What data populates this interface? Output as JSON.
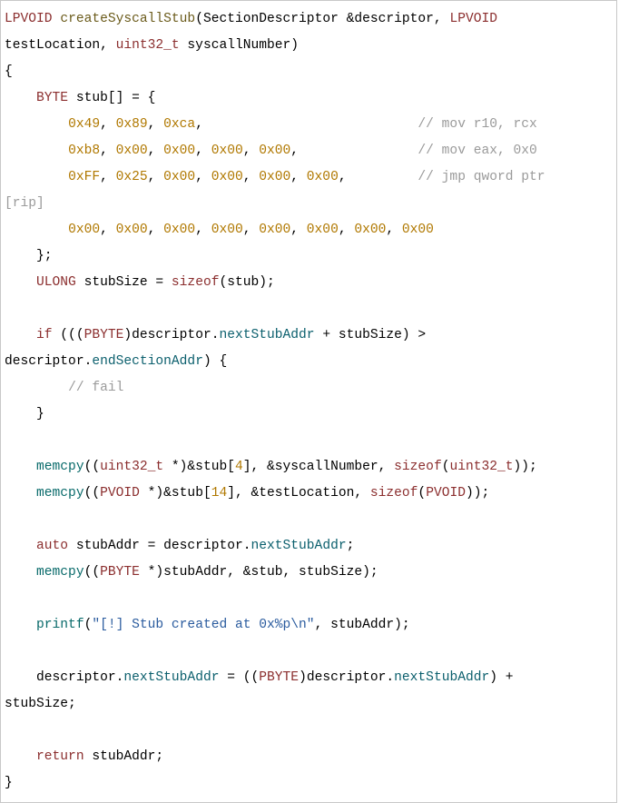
{
  "code": {
    "l1a": "LPVOID",
    "l1b": "createSyscallStub",
    "l1c": "(SectionDescriptor &descriptor, ",
    "l1d": "LPVOID",
    "l2a": "testLocation, ",
    "l2b": "uint32_t",
    "l2c": " syscallNumber)",
    "l3": "{",
    "l4a": "    ",
    "l4b": "BYTE",
    "l4c": " stub[] = {",
    "l5a": "        ",
    "l5b": "0x49",
    "l5c": ", ",
    "l5d": "0x89",
    "l5e": ", ",
    "l5f": "0xca",
    "l5g": ",                           ",
    "l5h": "// mov r10, rcx",
    "l6a": "        ",
    "l6b": "0xb8",
    "l6c": ", ",
    "l6d": "0x00",
    "l6e": ", ",
    "l6f": "0x00",
    "l6g": ", ",
    "l6h": "0x00",
    "l6i": ", ",
    "l6j": "0x00",
    "l6k": ",               ",
    "l6l": "// mov eax, 0x0",
    "l7a": "        ",
    "l7b": "0xFF",
    "l7c": ", ",
    "l7d": "0x25",
    "l7e": ", ",
    "l7f": "0x00",
    "l7g": ", ",
    "l7h": "0x00",
    "l7i": ", ",
    "l7j": "0x00",
    "l7k": ", ",
    "l7l": "0x00",
    "l7m": ",         ",
    "l7n": "// jmp qword ptr",
    "l8": "[rip]",
    "l9a": "        ",
    "l9b": "0x00",
    "l9c": ", ",
    "l9d": "0x00",
    "l9e": ", ",
    "l9f": "0x00",
    "l9g": ", ",
    "l9h": "0x00",
    "l9i": ", ",
    "l9j": "0x00",
    "l9k": ", ",
    "l9l": "0x00",
    "l9m": ", ",
    "l9n": "0x00",
    "l9o": ", ",
    "l9p": "0x00",
    "l10": "    };",
    "l11a": "    ",
    "l11b": "ULONG",
    "l11c": " stubSize = ",
    "l11d": "sizeof",
    "l11e": "(stub);",
    "l12": "",
    "l13a": "    ",
    "l13b": "if",
    "l13c": " (((",
    "l13d": "PBYTE",
    "l13e": ")descriptor.",
    "l13f": "nextStubAddr",
    "l13g": " + stubSize) >",
    "l14a": "descriptor.",
    "l14b": "endSectionAddr",
    "l14c": ") {",
    "l15a": "        ",
    "l15b": "// fail",
    "l16": "    }",
    "l17": "",
    "l18a": "    ",
    "l18b": "memcpy",
    "l18c": "((",
    "l18d": "uint32_t",
    "l18e": " *)&stub[",
    "l18f": "4",
    "l18g": "], &syscallNumber, ",
    "l18h": "sizeof",
    "l18i": "(",
    "l18j": "uint32_t",
    "l18k": "));",
    "l19a": "    ",
    "l19b": "memcpy",
    "l19c": "((",
    "l19d": "PVOID",
    "l19e": " *)&stub[",
    "l19f": "14",
    "l19g": "], &testLocation, ",
    "l19h": "sizeof",
    "l19i": "(",
    "l19j": "PVOID",
    "l19k": "));",
    "l20": "",
    "l21a": "    ",
    "l21b": "auto",
    "l21c": " stubAddr = descriptor.",
    "l21d": "nextStubAddr",
    "l21e": ";",
    "l22a": "    ",
    "l22b": "memcpy",
    "l22c": "((",
    "l22d": "PBYTE",
    "l22e": " *)stubAddr, &stub, stubSize);",
    "l23": "",
    "l24a": "    ",
    "l24b": "printf",
    "l24c": "(",
    "l24d": "\"[!] Stub created at 0x%p\\n\"",
    "l24e": ", stubAddr);",
    "l25": "",
    "l26a": "    descriptor.",
    "l26b": "nextStubAddr",
    "l26c": " = ((",
    "l26d": "PBYTE",
    "l26e": ")descriptor.",
    "l26f": "nextStubAddr",
    "l26g": ") +",
    "l27": "stubSize;",
    "l28": "",
    "l29a": "    ",
    "l29b": "return",
    "l29c": " stubAddr;",
    "l30": "}"
  }
}
